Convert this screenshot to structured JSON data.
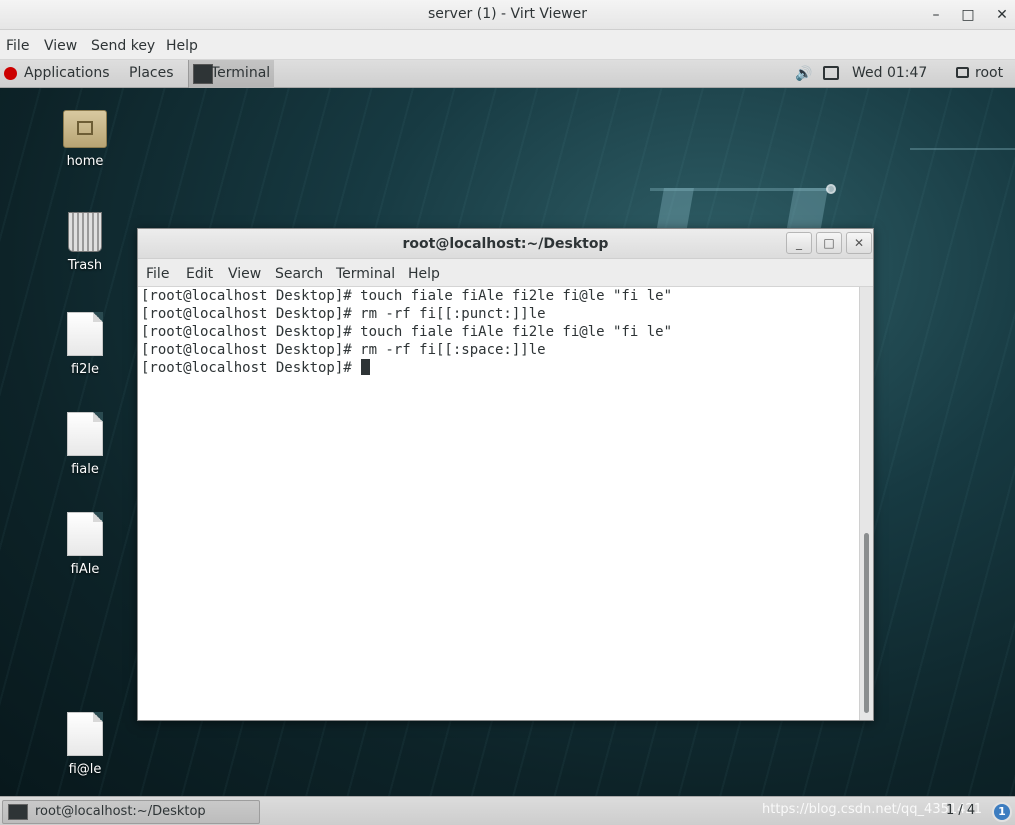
{
  "window": {
    "title": "server (1) - Virt Viewer",
    "minimize": "–",
    "maximize": "□",
    "close": "✕"
  },
  "menubar": {
    "file": "File",
    "view": "View",
    "send_key": "Send key",
    "help": "Help"
  },
  "top_panel": {
    "applications": "Applications",
    "places": "Places",
    "terminal_task": "Terminal",
    "clock": "Wed 01:47",
    "user": "root",
    "icons": [
      "redhat-icon",
      "terminal-icon",
      "volume-icon",
      "network-icon",
      "user-icon"
    ]
  },
  "desktop_icons": [
    {
      "label": "home",
      "icon": "home-folder-icon"
    },
    {
      "label": "Trash",
      "icon": "trash-icon"
    },
    {
      "label": "fi2le",
      "icon": "file-icon"
    },
    {
      "label": "fiale",
      "icon": "file-icon"
    },
    {
      "label": "fiAle",
      "icon": "file-icon"
    },
    {
      "label": "fi@le",
      "icon": "file-icon"
    }
  ],
  "terminal": {
    "title": "root@localhost:~/Desktop",
    "controls": {
      "minimize": "_",
      "maximize": "□",
      "close": "✕"
    },
    "menu": [
      "File",
      "Edit",
      "View",
      "Search",
      "Terminal",
      "Help"
    ],
    "lines": [
      "[root@localhost Desktop]# touch fiale fiAle fi2le fi@le \"fi le\"",
      "[root@localhost Desktop]# rm -rf fi[[:punct:]]le",
      "[root@localhost Desktop]# touch fiale fiAle fi2le fi@le \"fi le\"",
      "[root@localhost Desktop]# rm -rf fi[[:space:]]le",
      "[root@localhost Desktop]# "
    ]
  },
  "taskbar": {
    "task_label": "root@localhost:~/Desktop",
    "watermark": "https://blog.csdn.net/qq_4351421",
    "workspace": "1 / 4",
    "notifications": "1"
  }
}
